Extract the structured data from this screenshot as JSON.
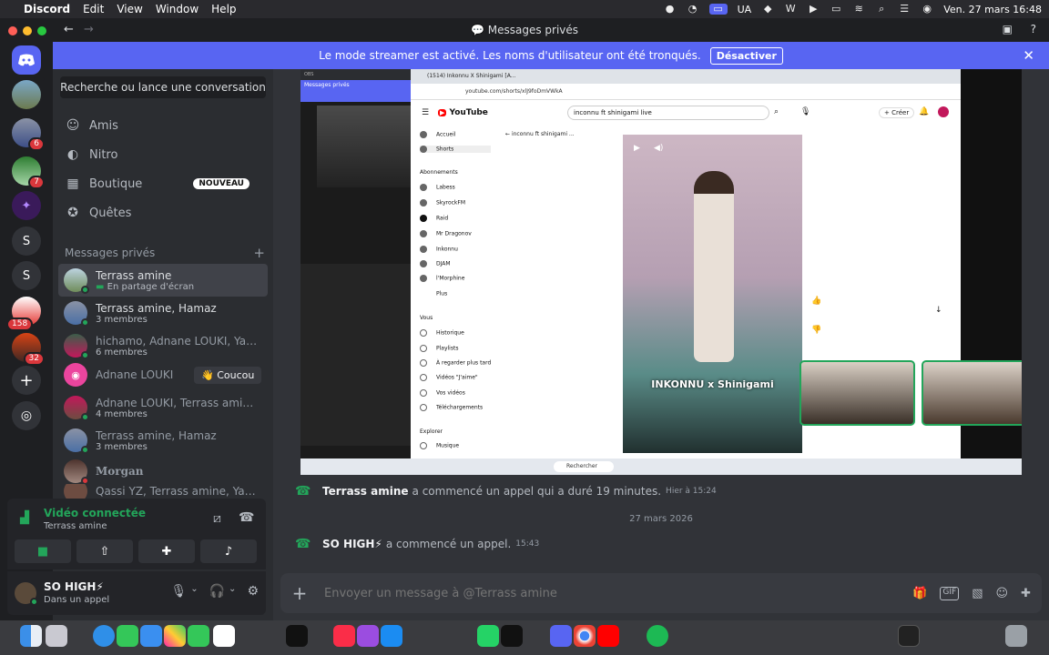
{
  "menubar": {
    "app": "Discord",
    "menus": [
      "Edit",
      "View",
      "Window",
      "Help"
    ],
    "keyboard": "UA",
    "clock": "Ven. 27 mars  16:48"
  },
  "window": {
    "title": "Messages privés"
  },
  "servers": [
    {
      "label": "",
      "badge": ""
    },
    {
      "label": "",
      "badge": "6"
    },
    {
      "label": "",
      "badge": "7"
    },
    {
      "label": "",
      "badge": ""
    },
    {
      "label": "S",
      "badge": ""
    },
    {
      "label": "S",
      "badge": ""
    },
    {
      "label": "",
      "badge": "158"
    },
    {
      "label": "",
      "badge": "32"
    }
  ],
  "banner": {
    "text": "Le mode streamer est activé. Les noms d'utilisateur ont été tronqués.",
    "button": "Désactiver"
  },
  "sidebar": {
    "search": "Recherche ou lance une conversation",
    "nav": [
      {
        "label": "Amis",
        "icon": "friends-icon"
      },
      {
        "label": "Nitro",
        "icon": "nitro-icon"
      },
      {
        "label": "Boutique",
        "icon": "shop-icon",
        "badge": "NOUVEAU"
      },
      {
        "label": "Quêtes",
        "icon": "quests-icon"
      }
    ],
    "dm_header": "Messages privés",
    "dms": [
      {
        "name": "Terrass amine",
        "sub": "En partage d'écran"
      },
      {
        "name": "Terrass amine, Hamaz",
        "sub": "3 membres"
      },
      {
        "name": "hichamo, Adnane LOUKI, Yassin...",
        "sub": "6 membres"
      },
      {
        "name": "Adnane LOUKI",
        "sub": "",
        "action": "👋 Coucou"
      },
      {
        "name": "Adnane LOUKI, Terrass amine, ...",
        "sub": "4 membres"
      },
      {
        "name": "Terrass amine, Hamaz",
        "sub": "3 membres"
      },
      {
        "name": "Morgan",
        "sub": ""
      },
      {
        "name": "Qassi YZ, Terrass amine, Yassine...",
        "sub": ""
      }
    ]
  },
  "voice": {
    "status": "Vidéo connectée",
    "channel": "Terrass amine"
  },
  "user": {
    "name": "SO HIGH⚡",
    "status": "Dans un appel"
  },
  "stream": {
    "obs_label": "Messages privés",
    "tab_title": "(1514) Inkonnu X Shinigami [A...",
    "url": "youtube.com/shorts/xlJ9foDmVWkA",
    "youtube": {
      "search": "inconnu ft shinigami live",
      "back_title": "inconnu ft shinigami ...",
      "nav": [
        "Accueil",
        "Shorts",
        "Abonnements",
        "Labess",
        "SkyrockFM",
        "Raid",
        "Mr Dragonov",
        "Inkonnu",
        "DJAM",
        "l'Morphine",
        "Plus",
        "Vous",
        "Historique",
        "Playlists",
        "À regarder plus tard",
        "Vidéos \"J'aime\"",
        "Vos vidéos",
        "Téléchargements",
        "Explorer",
        "Musique"
      ],
      "caption": "INKONNU x Shinigami"
    },
    "taskbar_search": "Rechercher"
  },
  "messages": [
    {
      "author": "Terrass amine",
      "text": "a commencé un appel qui a duré 19 minutes.",
      "time": "Hier à 15:24"
    },
    {
      "author": "SO HIGH⚡",
      "text": "a commencé un appel.",
      "time": "15:43"
    }
  ],
  "date_separator": "27 mars 2026",
  "composer": {
    "placeholder": "Envoyer un message à @Terrass amine"
  },
  "colors": {
    "blurple": "#5865f2",
    "green": "#23a55a",
    "red": "#da373c"
  }
}
